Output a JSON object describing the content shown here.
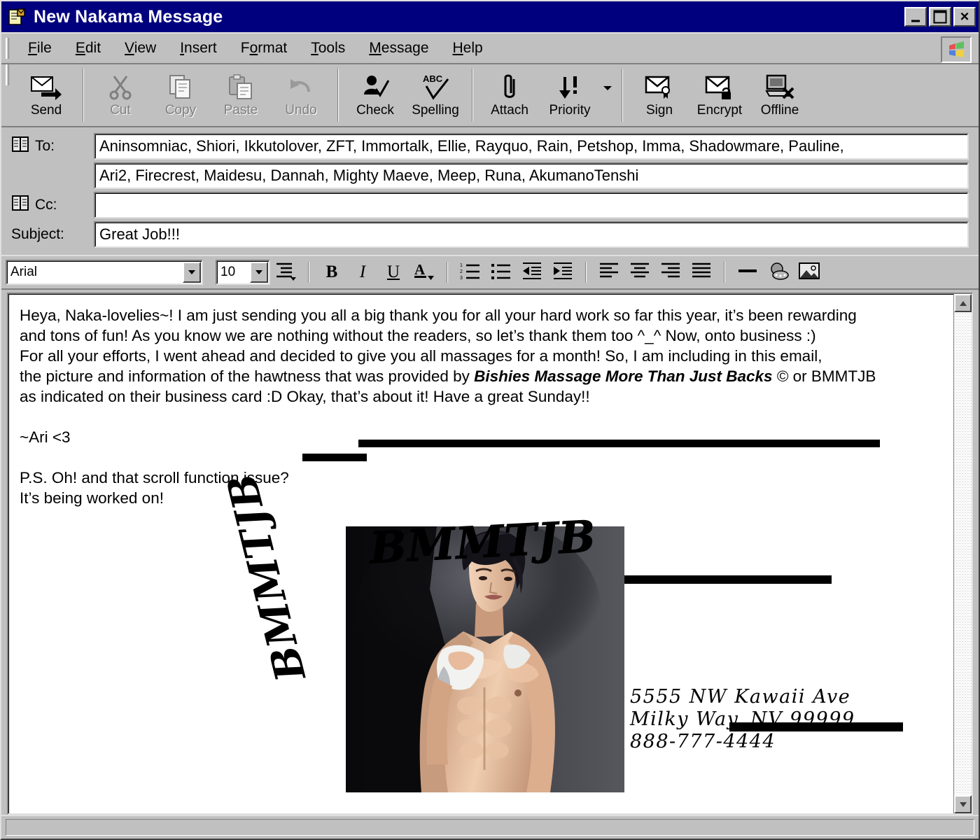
{
  "window": {
    "title": "New Nakama Message",
    "icon": "message-window-icon",
    "controls": {
      "minimize": "_",
      "maximize": "□",
      "close": "✕"
    }
  },
  "menubar": {
    "items": [
      {
        "name": "file",
        "pre": "",
        "key": "F",
        "post": "ile"
      },
      {
        "name": "edit",
        "pre": "",
        "key": "E",
        "post": "dit"
      },
      {
        "name": "view",
        "pre": "",
        "key": "V",
        "post": "iew"
      },
      {
        "name": "insert",
        "pre": "",
        "key": "I",
        "post": "nsert"
      },
      {
        "name": "format",
        "pre": "F",
        "key": "o",
        "post": "rmat"
      },
      {
        "name": "tools",
        "pre": "",
        "key": "T",
        "post": "ools"
      },
      {
        "name": "message",
        "pre": "",
        "key": "M",
        "post": "essage"
      },
      {
        "name": "help",
        "pre": "",
        "key": "H",
        "post": "elp"
      }
    ],
    "logo": "windows-logo-icon"
  },
  "toolbar": {
    "buttons": [
      {
        "name": "send",
        "label": "Send",
        "icon": "send-envelope-icon",
        "disabled": false
      },
      {
        "name": "cut",
        "label": "Cut",
        "icon": "scissors-icon",
        "disabled": true
      },
      {
        "name": "copy",
        "label": "Copy",
        "icon": "copy-pages-icon",
        "disabled": true
      },
      {
        "name": "paste",
        "label": "Paste",
        "icon": "clipboard-paste-icon",
        "disabled": true
      },
      {
        "name": "undo",
        "label": "Undo",
        "icon": "undo-arrow-icon",
        "disabled": true
      },
      {
        "name": "check",
        "label": "Check",
        "icon": "check-names-icon",
        "disabled": false
      },
      {
        "name": "spelling",
        "label": "Spelling",
        "icon": "abc-spellcheck-icon",
        "disabled": false
      },
      {
        "name": "attach",
        "label": "Attach",
        "icon": "paperclip-icon",
        "disabled": false
      },
      {
        "name": "priority",
        "label": "Priority",
        "icon": "priority-arrow-icon",
        "disabled": false
      },
      {
        "name": "sign",
        "label": "Sign",
        "icon": "sign-envelope-icon",
        "disabled": false
      },
      {
        "name": "encrypt",
        "label": "Encrypt",
        "icon": "lock-envelope-icon",
        "disabled": false
      },
      {
        "name": "offline",
        "label": "Offline",
        "icon": "offline-monitor-icon",
        "disabled": false
      }
    ]
  },
  "headers": {
    "to_label": "To:",
    "to_line1": "Aninsomniac, Shiori, Ikkutolover, ZFT, Immortalk, Ellie, Rayquo, Rain, Petshop, Imma, Shadowmare, Pauline,",
    "to_line2": "Ari2, Firecrest, Maidesu, Dannah, Mighty Maeve, Meep, Runa, AkumanoTenshi",
    "cc_label": "Cc:",
    "cc_value": "",
    "subject_label": "Subject:",
    "subject_value": "Great Job!!!",
    "book_icon": "address-book-icon"
  },
  "format_toolbar": {
    "font_name": "Arial",
    "font_size": "10",
    "buttons": [
      {
        "name": "paragraph-style",
        "icon": "paragraph-style-icon",
        "glyph": ""
      },
      {
        "name": "bold",
        "icon": "bold-icon",
        "glyph": "B"
      },
      {
        "name": "italic",
        "icon": "italic-icon",
        "glyph": "I"
      },
      {
        "name": "underline",
        "icon": "underline-icon",
        "glyph": "U"
      },
      {
        "name": "font-color",
        "icon": "font-color-icon",
        "glyph": "A"
      },
      {
        "name": "numbered-list",
        "icon": "numbered-list-icon",
        "glyph": ""
      },
      {
        "name": "bulleted-list",
        "icon": "bulleted-list-icon",
        "glyph": ""
      },
      {
        "name": "decrease-indent",
        "icon": "decrease-indent-icon",
        "glyph": ""
      },
      {
        "name": "increase-indent",
        "icon": "increase-indent-icon",
        "glyph": ""
      },
      {
        "name": "align-left",
        "icon": "align-left-icon",
        "glyph": ""
      },
      {
        "name": "align-center",
        "icon": "align-center-icon",
        "glyph": ""
      },
      {
        "name": "align-right",
        "icon": "align-right-icon",
        "glyph": ""
      },
      {
        "name": "justify",
        "icon": "justify-icon",
        "glyph": ""
      },
      {
        "name": "horizontal-rule",
        "icon": "horizontal-rule-icon",
        "glyph": ""
      },
      {
        "name": "insert-link",
        "icon": "insert-link-icon",
        "glyph": ""
      },
      {
        "name": "insert-picture",
        "icon": "insert-picture-icon",
        "glyph": ""
      }
    ]
  },
  "body": {
    "line1": "Heya, Naka-lovelies~! I am just sending you all a big thank you for all your hard work so far this year, it’s been rewarding",
    "line2": "and tons of fun! As you know we are nothing without the readers, so let’s thank them too ^_^ Now, onto business :)",
    "line3": "For all your efforts, I went ahead and decided to give you all massages for a month! So, I am including in this email,",
    "line4_a": "the picture and information of the hawtness that was provided by ",
    "line4_b": "Bishies Massage More Than Just Backs",
    "line4_c": " © or BMMTJB",
    "line5": "as indicated on their business card :D Okay, that’s about it! Have a great Sunday!!",
    "signature": "~Ari <3",
    "ps_line1": "P.S. Oh! and that scroll function issue?",
    "ps_line2": "It’s being worked on!"
  },
  "business_card": {
    "logo_top": "BMMTJB",
    "logo_side": "BMMTJB",
    "address_line1": "5555 NW Kawaii Ave",
    "address_line2": "Milky Way, NV 99999",
    "address_line3": "888-777-4444",
    "photo_alt": "shirtless-bishie-masseur-photo"
  },
  "scrollbar": {
    "up": "scroll-up-arrow-icon",
    "down": "scroll-down-arrow-icon"
  },
  "colors": {
    "titlebar": "#00007e",
    "chrome": "#c0c0c0",
    "field_bg": "#ffffff",
    "text": "#000000",
    "disabled_text": "#808080"
  }
}
